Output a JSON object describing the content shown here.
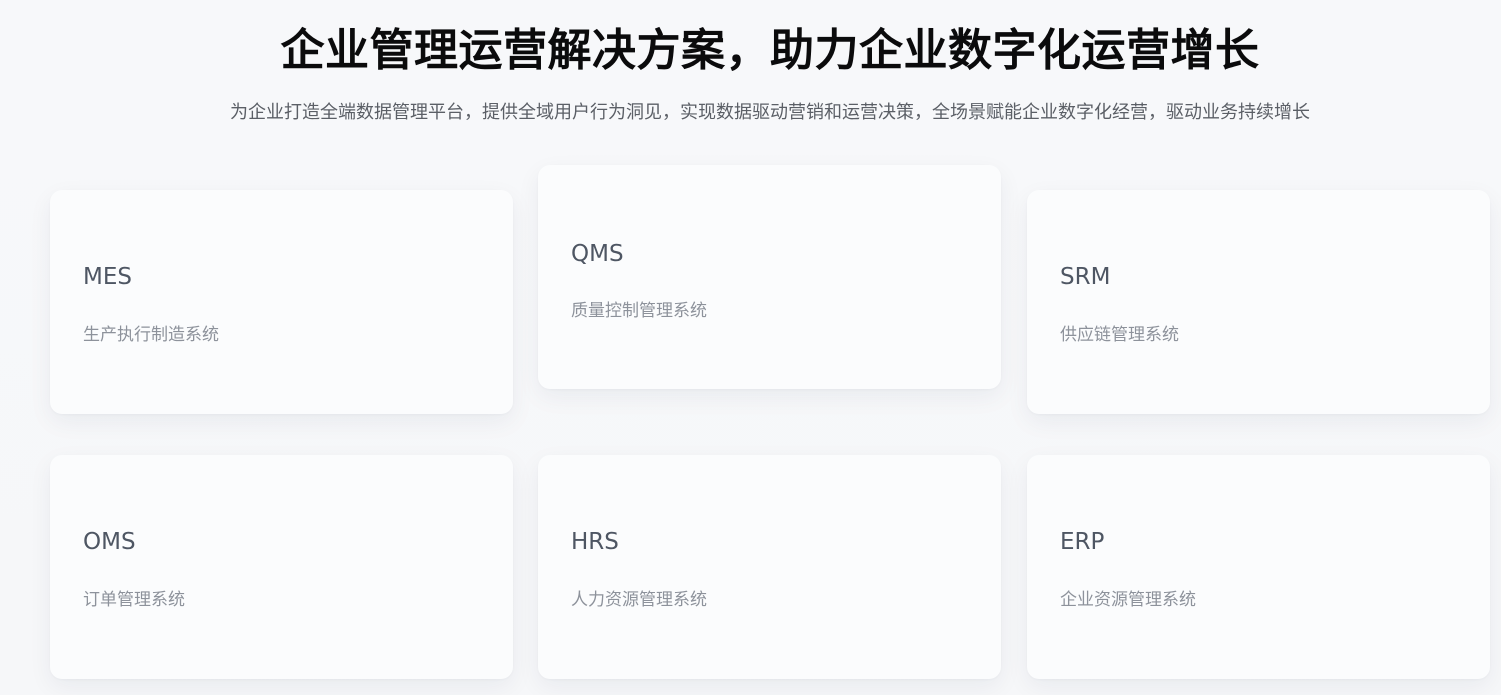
{
  "header": {
    "title": "企业管理运营解决方案，助力企业数字化运营增长",
    "subtitle": "为企业打造全端数据管理平台，提供全域用户行为洞见，实现数据驱动营销和运营决策，全场景赋能企业数字化经营，驱动业务持续增长"
  },
  "cards": [
    {
      "code": "MES",
      "desc": "生产执行制造系统"
    },
    {
      "code": "QMS",
      "desc": "质量控制管理系统"
    },
    {
      "code": "SRM",
      "desc": "供应链管理系统"
    },
    {
      "code": "OMS",
      "desc": "订单管理系统"
    },
    {
      "code": "HRS",
      "desc": "人力资源管理系统"
    },
    {
      "code": "ERP",
      "desc": "企业资源管理系统"
    }
  ]
}
